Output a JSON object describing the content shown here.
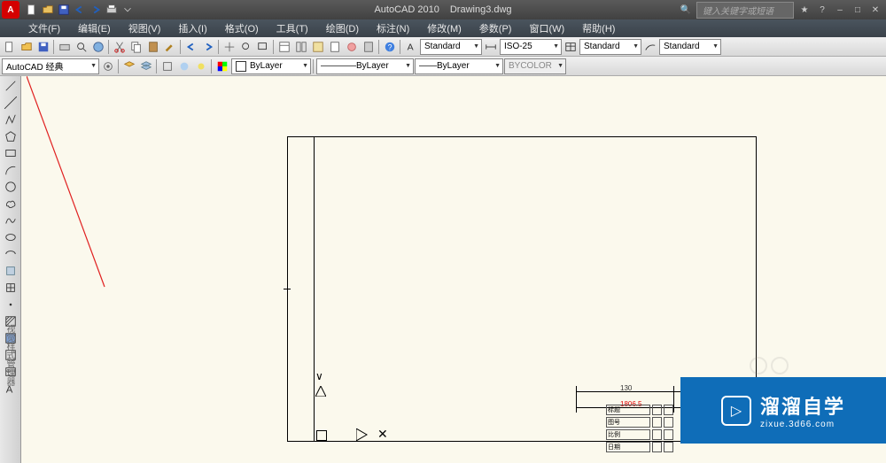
{
  "title": {
    "app": "AutoCAD 2010",
    "doc": "Drawing3.dwg"
  },
  "search_hint": "键入关键字或短语",
  "menu": [
    {
      "label": "文件(F)"
    },
    {
      "label": "编辑(E)"
    },
    {
      "label": "视图(V)"
    },
    {
      "label": "插入(I)"
    },
    {
      "label": "格式(O)"
    },
    {
      "label": "工具(T)"
    },
    {
      "label": "绘图(D)"
    },
    {
      "label": "标注(N)"
    },
    {
      "label": "修改(M)"
    },
    {
      "label": "参数(P)"
    },
    {
      "label": "窗口(W)"
    },
    {
      "label": "帮助(H)"
    }
  ],
  "styles": {
    "text_style": "Standard",
    "dim_style": "ISO-25",
    "table_style": "Standard",
    "ml_style": "Standard"
  },
  "workspace": {
    "name": "AutoCAD 经典"
  },
  "layer": {
    "current": "ByLayer",
    "linetype": "ByLayer",
    "lineweight": "ByLayer",
    "plot_style": "BYCOLOR"
  },
  "titleblock": {
    "rows": [
      "标题",
      "图号",
      "比例",
      "日期"
    ],
    "dim_label": "130",
    "small_red": "1806.5"
  },
  "watermark": {
    "brand": "溜溜自学",
    "url": "zixue.3d66.com"
  },
  "app_letter": "A"
}
